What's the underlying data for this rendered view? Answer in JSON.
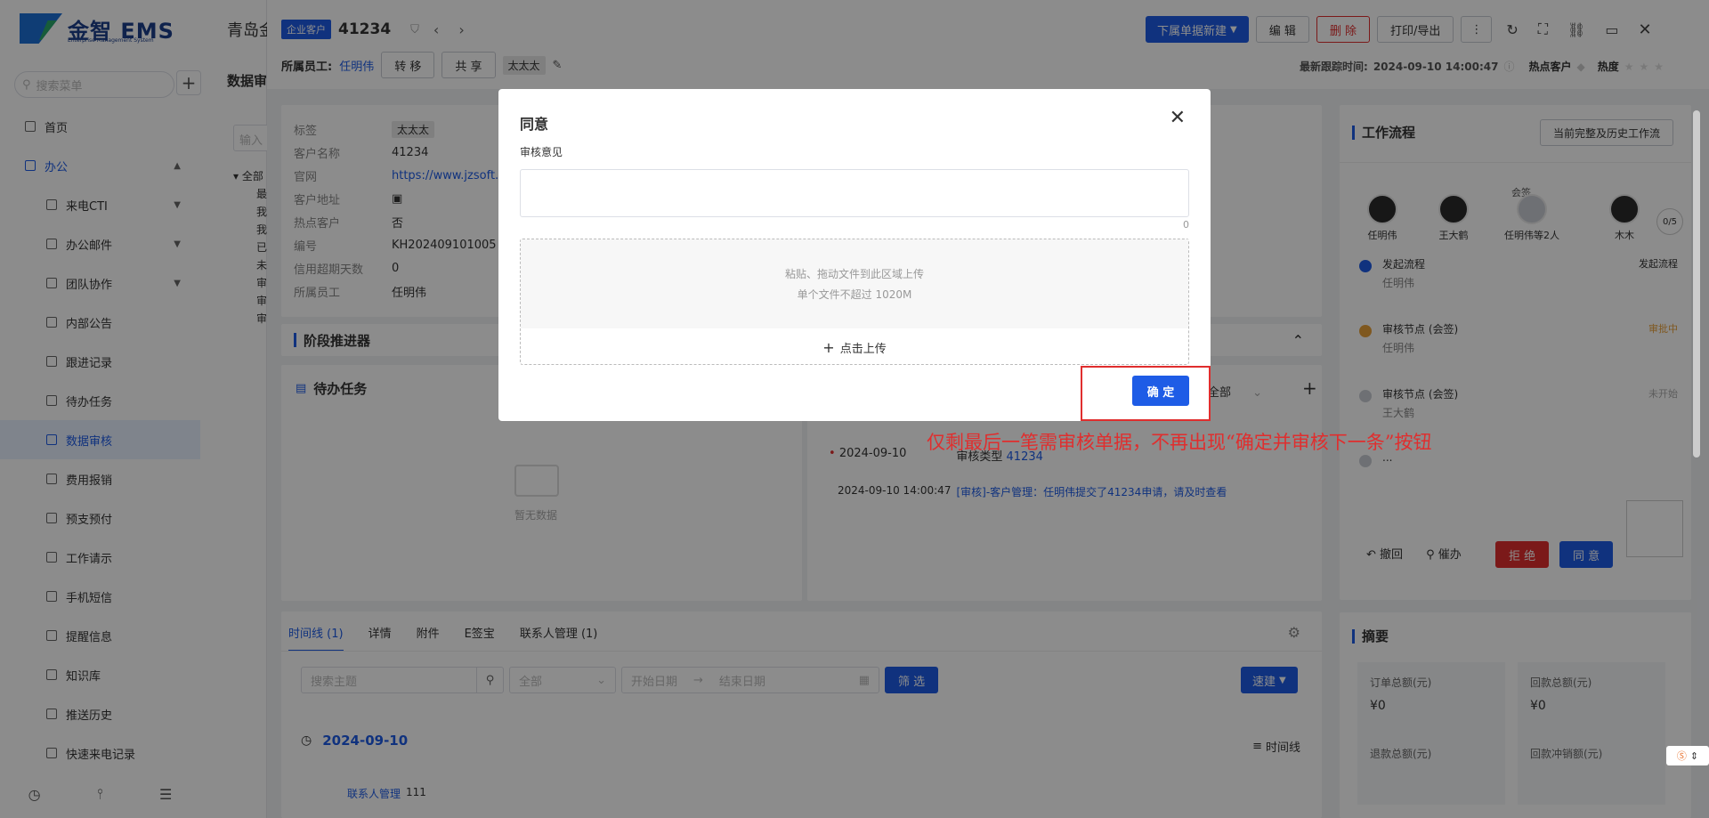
{
  "brand": {
    "logo_text": "金智 EMS",
    "logo_sub": "Enterprise Management System"
  },
  "sidebar": {
    "search_placeholder": "搜索菜单",
    "items": [
      {
        "label": "首页",
        "level": 0
      },
      {
        "label": "办公",
        "level": 0,
        "open": true
      },
      {
        "label": "来电CTI",
        "level": 1,
        "chevron": true
      },
      {
        "label": "办公邮件",
        "level": 1,
        "chevron": true
      },
      {
        "label": "团队协作",
        "level": 1,
        "chevron": true
      },
      {
        "label": "内部公告",
        "level": 1
      },
      {
        "label": "跟进记录",
        "level": 1
      },
      {
        "label": "待办任务",
        "level": 1
      },
      {
        "label": "数据审核",
        "level": 1,
        "active": true
      },
      {
        "label": "费用报销",
        "level": 1
      },
      {
        "label": "预支预付",
        "level": 1
      },
      {
        "label": "工作请示",
        "level": 1
      },
      {
        "label": "手机短信",
        "level": 1
      },
      {
        "label": "提醒信息",
        "level": 1
      },
      {
        "label": "知识库",
        "level": 1
      },
      {
        "label": "推送历史",
        "level": 1
      },
      {
        "label": "快速来电记录",
        "level": 1
      }
    ]
  },
  "background": {
    "page_title": "青岛金",
    "section_title": "数据审",
    "filter_placeholder": "输入",
    "tree_root": "全部",
    "tree_items": [
      "最",
      "我",
      "我",
      "已",
      "未",
      "审",
      "审",
      "审"
    ]
  },
  "record": {
    "type_tag": "企业客户",
    "id": "41234",
    "owner_label": "所属员工:",
    "owner": "任明伟",
    "transfer_btn": "转 移",
    "share_btn": "共 享",
    "tag": "太太太",
    "new_btn": "下属单据新建",
    "edit_btn": "编 辑",
    "delete_btn": "删 除",
    "print_btn": "打印/导出",
    "last_follow_label": "最新跟踪时间:",
    "last_follow": "2024-09-10 14:00:47",
    "hot_label": "热点客户",
    "heat_label": "热度"
  },
  "details": [
    {
      "k": "标签",
      "v": "太太太",
      "type": "tag"
    },
    {
      "k": "客户名称",
      "v": "41234"
    },
    {
      "k": "官网",
      "v": "https://www.jzsoft.c",
      "type": "link"
    },
    {
      "k": "客户地址",
      "v": "▣"
    },
    {
      "k": "热点客户",
      "v": "否"
    },
    {
      "k": "编号",
      "v": "KH202409101005"
    },
    {
      "k": "信用超期天数",
      "v": "0"
    },
    {
      "k": "所属员工",
      "v": "任明伟"
    }
  ],
  "stage": {
    "title": "阶段推进器"
  },
  "todo": {
    "title": "待办任务",
    "empty": "暂无数据"
  },
  "activity": {
    "filter": "全部",
    "row1_date": "2024-09-10",
    "row1_type": "审核类型",
    "row1_link": "41234",
    "row2_time": "2024-09-10 14:00:47",
    "row2_text": "[审核]-客户管理：任明伟提交了41234申请，请及时查看"
  },
  "tabs": [
    {
      "label": "时间线 (1)",
      "active": true
    },
    {
      "label": "详情"
    },
    {
      "label": "附件"
    },
    {
      "label": "E签宝"
    },
    {
      "label": "联系人管理 (1)"
    }
  ],
  "timeline": {
    "search_placeholder": "搜索主题",
    "type_filter": "全部",
    "start_placeholder": "开始日期",
    "end_placeholder": "结束日期",
    "filter_btn": "筛 选",
    "quick_btn": "速建",
    "date": "2024-09-10",
    "view_label": "时间线",
    "entry_module": "联系人管理",
    "entry_value": "111"
  },
  "workflow": {
    "title": "工作流程",
    "history_btn": "当前完整及历史工作流",
    "countersign_label": "会签",
    "people": [
      "任明伟",
      "王大鹤",
      "任明伟等2人",
      "木木"
    ],
    "progress": "0/5",
    "steps": [
      {
        "name": "发起流程",
        "person": "任明伟",
        "status": "发起流程"
      },
      {
        "name": "审核节点 (会签)",
        "person": "任明伟",
        "status": "审批中"
      },
      {
        "name": "审核节点 (会签)",
        "person": "王大鹤",
        "status": "未开始"
      },
      {
        "name": "...",
        "person": "",
        "status": ""
      }
    ],
    "revoke": "撤回",
    "urge": "催办",
    "reject": "拒 绝",
    "approve": "同 意"
  },
  "summary": {
    "title": "摘要",
    "items": [
      {
        "label": "订单总额(元)",
        "value": "¥0"
      },
      {
        "label": "回款总额(元)",
        "value": "¥0"
      },
      {
        "label": "退款总额(元)",
        "value": ""
      },
      {
        "label": "回款冲销额(元)",
        "value": ""
      }
    ]
  },
  "modal": {
    "title": "同意",
    "field_label": "审核意见",
    "char_count": "0",
    "upload_hint1": "粘贴、拖动文件到此区域上传",
    "upload_hint2": "单个文件不超过 1020M",
    "upload_btn": "点击上传",
    "confirm": "确 定"
  },
  "annotation": {
    "text": "仅剩最后一笔需审核单据，不再出现“确定并审核下一条”按钮",
    "color": "#e02e2e"
  },
  "colors": {
    "primary": "#1e5ce6",
    "danger": "#e02e2e",
    "active_bg": "#e8f0ff"
  }
}
